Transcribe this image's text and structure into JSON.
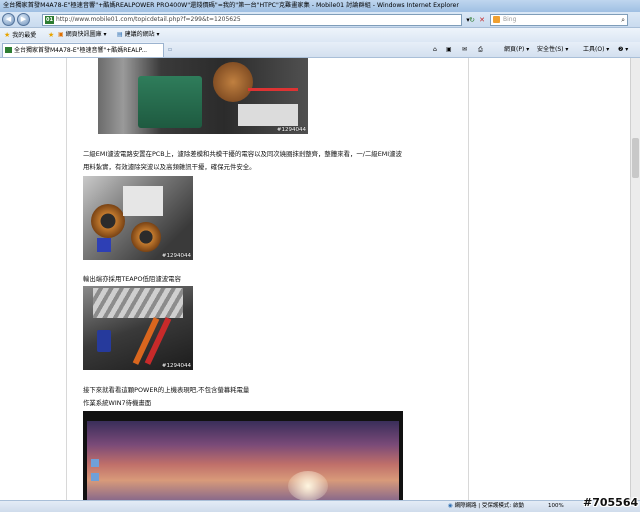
{
  "window": {
    "title": "全台獨家首發M4A78-E\"極速音響\"+酷媽REALPOWER PRO400W\"還錢價碼\"=我的\"第一台\"HTPC\"克難畫家集 - Mobile01 討論群組 - Windows Internet Explorer"
  },
  "address": {
    "url": "http://www.mobile01.com/topicdetail.php?f=299&t=1205625",
    "site_icon": "01",
    "search_placeholder": "Bing"
  },
  "favorites": {
    "label": "我的最愛",
    "items": [
      "建議的網站 ▾",
      "網頁快訊圖庫 ▾"
    ]
  },
  "tab": {
    "label": "全台獨家首發M4A78-E\"極速音響\"+酷媽REALP..."
  },
  "commands": {
    "page": "網頁(P) ▾",
    "safety": "安全性(S) ▾",
    "tools": "工具(O) ▾",
    "help": "❷ ▾"
  },
  "content": {
    "photo1_watermark": "#1294044",
    "para1_line1": "二級EMI濾波電路安置在PCB上，濾除差模和共模干擾的電容以及同次繞圈抹剎整齊，整體來看，一/二級EMI濾波",
    "para1_line2": "用料紮實，有效濾除突波以及高頻雜訊干擾，確保元件安全。",
    "photo2_watermark": "#1294044",
    "para2": "輸出端亦採用TEAPO低阻濾波電容",
    "photo3_watermark": "#1294044",
    "para3_line1": "接下來就看看這顆POWER的上機表現吧,不包含螢幕耗電量",
    "para3_line2": "作業系統WIN7待機畫面"
  },
  "status": {
    "zone": "網際網路 | 受保護模式: 啟動",
    "zoom": "100%"
  },
  "overlay_id": "#705564"
}
